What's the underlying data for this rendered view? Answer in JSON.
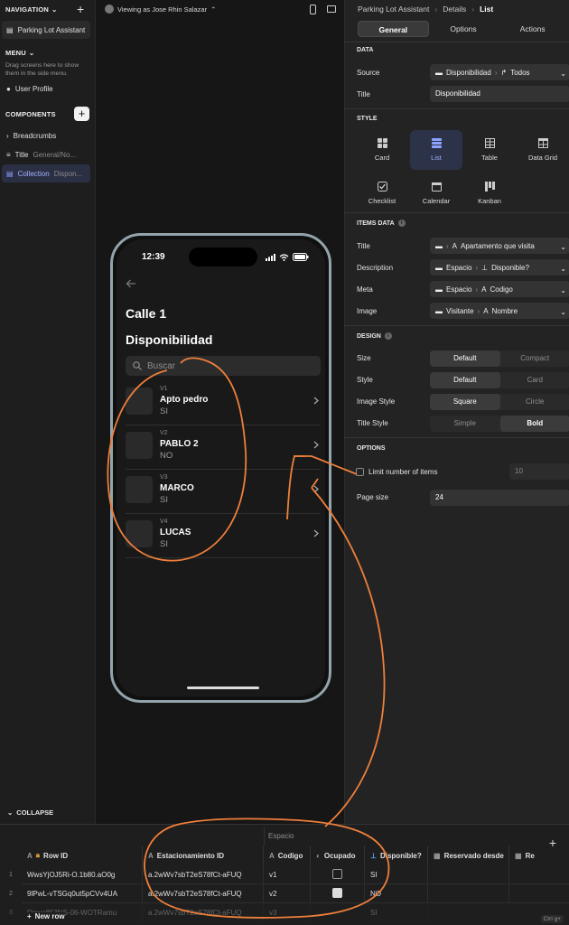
{
  "left": {
    "navigation_label": "NAVIGATION",
    "nav_items": [
      {
        "label": "Parking Lot Assistant"
      }
    ],
    "menu_label": "MENU",
    "menu_hint": "Drag screens here to show them in the side menu.",
    "menu_items": [
      {
        "label": "User Profile"
      }
    ],
    "components_label": "COMPONENTS",
    "components": [
      {
        "label": "Breadcrumbs",
        "sub": ""
      },
      {
        "label": "Title",
        "sub": "General/No..."
      },
      {
        "label": "Collection",
        "sub": "Dispon..."
      }
    ],
    "collapse_label": "COLLAPSE"
  },
  "canvas": {
    "viewing_as": "Viewing as Jose Rhin Salazar",
    "phone": {
      "time": "12:39",
      "title": "Calle 1",
      "subtitle": "Disponibilidad",
      "search_placeholder": "Buscar",
      "items": [
        {
          "meta": "V1",
          "title": "Apto pedro",
          "desc": "SI"
        },
        {
          "meta": "V2",
          "title": "PABLO 2",
          "desc": "NO"
        },
        {
          "meta": "V3",
          "title": "MARCO",
          "desc": "SI"
        },
        {
          "meta": "V4",
          "title": "LUCAS",
          "desc": "SI"
        }
      ]
    }
  },
  "right": {
    "breadcrumbs": [
      "Parking Lot Assistant",
      "Details",
      "List"
    ],
    "tabs": [
      "General",
      "Options",
      "Actions"
    ],
    "active_tab": "General",
    "data_section": "DATA",
    "source_label": "Source",
    "source_value": "Disponibilidad",
    "source_filter": "Todos",
    "title_label": "Title",
    "title_value": "Disponibilidad",
    "style_section": "STYLE",
    "styles": [
      "Card",
      "List",
      "Table",
      "Data Grid",
      "Checklist",
      "Calendar",
      "Kanban"
    ],
    "active_style": "List",
    "items_data_section": "ITEMS DATA",
    "items_data": [
      {
        "label": "Title",
        "path": [
          "",
          "Apartamento que visita"
        ]
      },
      {
        "label": "Description",
        "path": [
          "Espacio",
          "Disponible?"
        ]
      },
      {
        "label": "Meta",
        "path": [
          "Espacio",
          "Codigo"
        ]
      },
      {
        "label": "Image",
        "path": [
          "Visitante",
          "Nombre"
        ]
      }
    ],
    "design_section": "DESIGN",
    "design": [
      {
        "label": "Size",
        "options": [
          "Default",
          "Compact"
        ],
        "selected": 0
      },
      {
        "label": "Style",
        "options": [
          "Default",
          "Card"
        ],
        "selected": 0
      },
      {
        "label": "Image Style",
        "options": [
          "Square",
          "Circle"
        ],
        "selected": 0
      },
      {
        "label": "Title Style",
        "options": [
          "Simple",
          "Bold"
        ],
        "selected": 1
      }
    ],
    "options_section": "OPTIONS",
    "limit_label": "Limit number of items",
    "limit_value": "10",
    "page_size_label": "Page size",
    "page_size_value": "24"
  },
  "table": {
    "group_label": "Espacio",
    "columns": [
      "Row ID",
      "Estacionamiento ID",
      "Codigo",
      "Ocupado",
      "Disponible?",
      "Reservado desde",
      "Re"
    ],
    "rows": [
      {
        "n": "1",
        "row_id": "WwsYjOJ5Ri-O.1b80.aO0g",
        "est_id": "a.2wWv7sbT2eS78fCt-aFUQ",
        "codigo": "v1",
        "ocupado": false,
        "disponible": "SI"
      },
      {
        "n": "2",
        "row_id": "9lPwL-vTSGq0ut5pCVv4UA",
        "est_id": "a.2wWv7sbT2eS78fCt-aFUQ",
        "codigo": "v2",
        "ocupado": true,
        "disponible": "NO"
      },
      {
        "n": "3",
        "row_id": "Dpwa853NS-06-WOTRamu",
        "est_id": "a.2wWv7sbT2eS78fCt-aFUQ",
        "codigo": "v3",
        "ocupado": false,
        "disponible": "SI"
      }
    ],
    "new_row_label": "New row",
    "ctrl_hint": "Ctrl g+"
  },
  "annotation_color": "#ee7f3b"
}
